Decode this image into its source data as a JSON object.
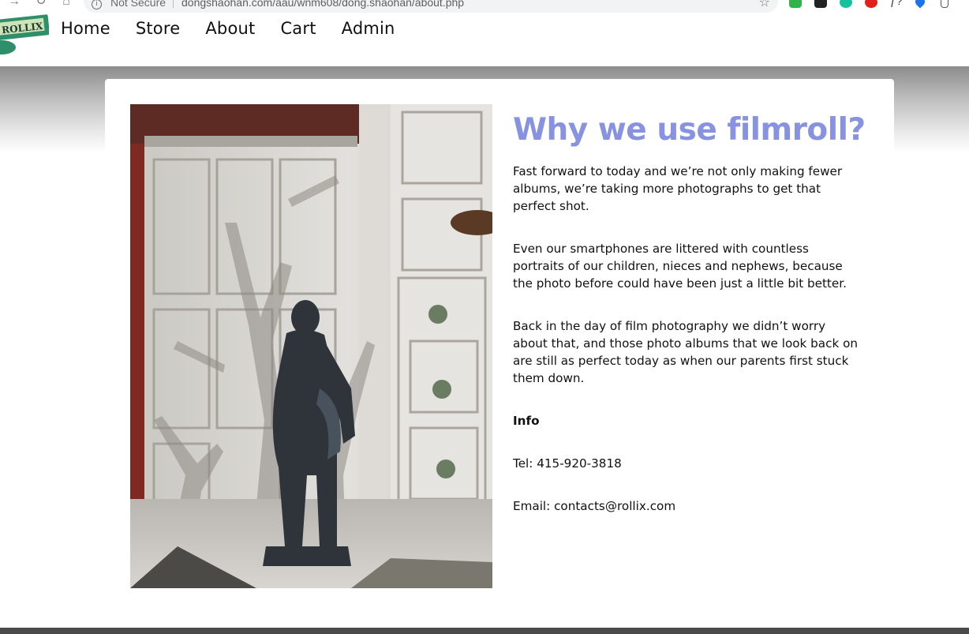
{
  "browser": {
    "security_label": "Not Secure",
    "url": "dongshaohan.com/aau/wnm608/dong.shaohan/about.php"
  },
  "site": {
    "logo_text": "ROLLIX",
    "nav": [
      {
        "label": "Home"
      },
      {
        "label": "Store"
      },
      {
        "label": "About"
      },
      {
        "label": "Cart"
      },
      {
        "label": "Admin"
      }
    ]
  },
  "about": {
    "heading": "Why we use filmroll?",
    "paragraphs": [
      "Fast forward to today and we’re not only making fewer albums, we’re taking more photographs to get that perfect shot.",
      "Even our smartphones are littered with countless portraits of our children, nieces and nephews, because the photo before could have been just a little bit better.",
      "Back in the day of film photography we didn’t worry about that, and those photo albums that we look back on are still as perfect today as when our parents first stuck them down."
    ],
    "info_label": "Info",
    "tel": "Tel: 415-920-3818",
    "email": "Email: contacts@rollix.com"
  },
  "colors": {
    "heading_accent": "#8792e0",
    "logo_green": "#2e8f6a"
  },
  "icons": [
    "forward-icon",
    "reload-icon",
    "home-icon",
    "info-icon",
    "bookmark-star-icon"
  ]
}
